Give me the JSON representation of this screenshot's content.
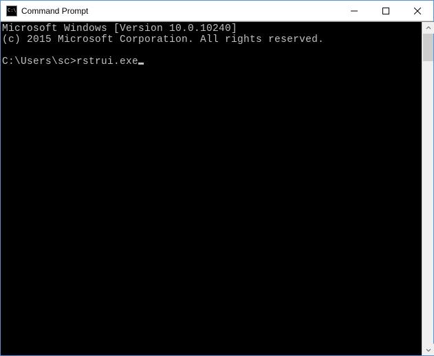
{
  "window": {
    "title": "Command Prompt",
    "icon_glyph": "C:\\"
  },
  "terminal": {
    "line1": "Microsoft Windows [Version 10.0.10240]",
    "line2": "(c) 2015 Microsoft Corporation. All rights reserved.",
    "prompt": "C:\\Users\\sc>",
    "command": "rstrui.exe"
  }
}
